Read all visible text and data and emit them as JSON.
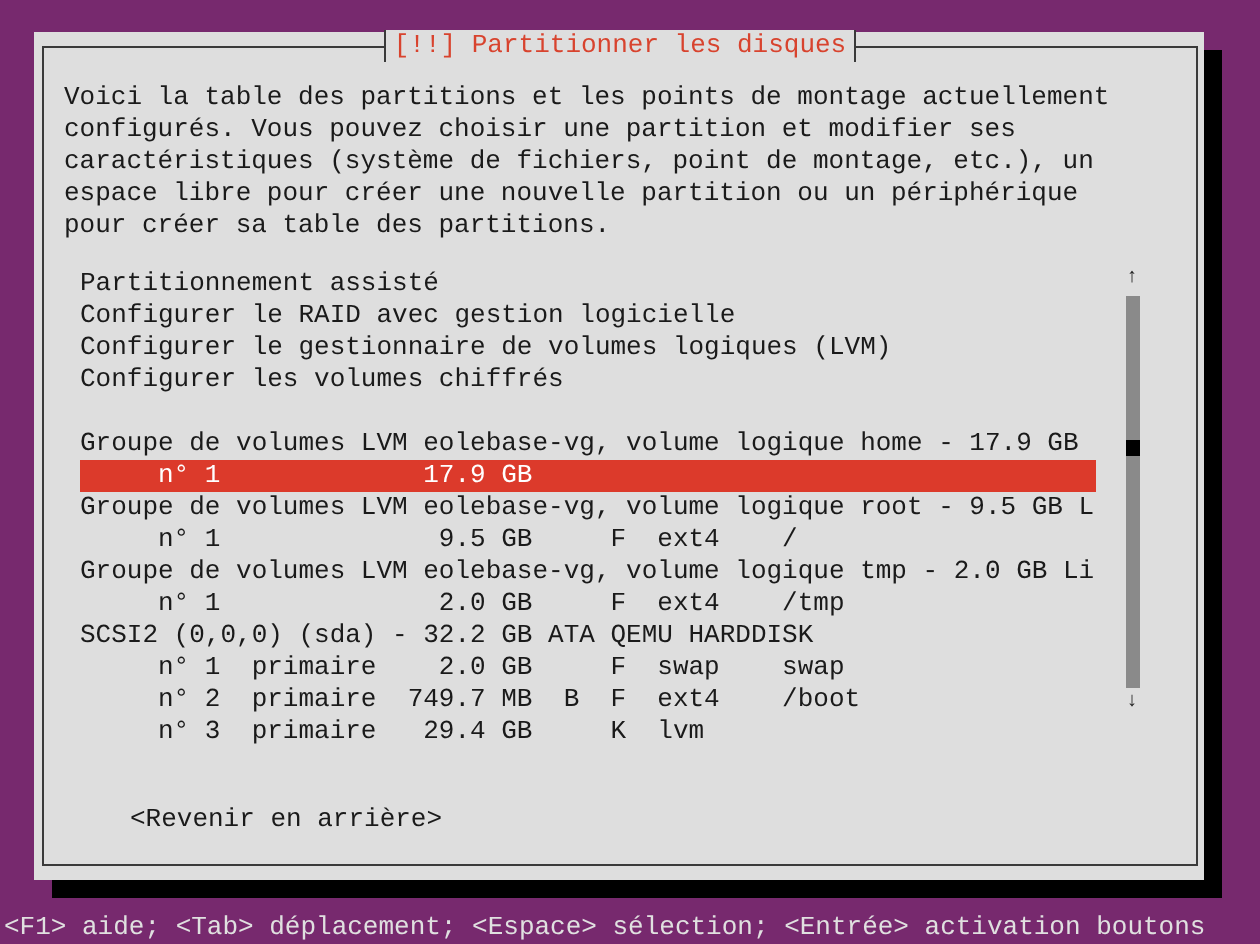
{
  "dialog": {
    "title": "[!!] Partitionner les disques",
    "description": "Voici la table des partitions et les points de montage actuellement\nconfigurés. Vous pouvez choisir une partition et modifier ses\ncaractéristiques (système de fichiers, point de montage, etc.), un\nespace libre pour créer une nouvelle partition ou un périphérique\npour créer sa table des partitions.",
    "list": [
      {
        "kind": "item",
        "text": "Partitionnement assisté",
        "selected": false
      },
      {
        "kind": "item",
        "text": "Configurer le RAID avec gestion logicielle",
        "selected": false
      },
      {
        "kind": "item",
        "text": "Configurer le gestionnaire de volumes logiques (LVM)",
        "selected": false
      },
      {
        "kind": "item",
        "text": "Configurer les volumes chiffrés",
        "selected": false
      },
      {
        "kind": "blank"
      },
      {
        "kind": "item",
        "text": "Groupe de volumes LVM eolebase-vg, volume logique home - 17.9 GB",
        "selected": false
      },
      {
        "kind": "item",
        "text": "     n° 1             17.9 GB",
        "selected": true
      },
      {
        "kind": "item",
        "text": "Groupe de volumes LVM eolebase-vg, volume logique root - 9.5 GB L",
        "selected": false
      },
      {
        "kind": "item",
        "text": "     n° 1              9.5 GB     F  ext4    /",
        "selected": false
      },
      {
        "kind": "item",
        "text": "Groupe de volumes LVM eolebase-vg, volume logique tmp - 2.0 GB Li",
        "selected": false
      },
      {
        "kind": "item",
        "text": "     n° 1              2.0 GB     F  ext4    /tmp",
        "selected": false
      },
      {
        "kind": "item",
        "text": "SCSI2 (0,0,0) (sda) - 32.2 GB ATA QEMU HARDDISK",
        "selected": false
      },
      {
        "kind": "item",
        "text": "     n° 1  primaire    2.0 GB     F  swap    swap",
        "selected": false
      },
      {
        "kind": "item",
        "text": "     n° 2  primaire  749.7 MB  B  F  ext4    /boot",
        "selected": false
      },
      {
        "kind": "item",
        "text": "     n° 3  primaire   29.4 GB     K  lvm",
        "selected": false
      }
    ],
    "scroll_up": "↑",
    "scroll_down": "↓",
    "back_button": "<Revenir en arrière>"
  },
  "status_bar": "<F1> aide; <Tab> déplacement; <Espace> sélection; <Entrée> activation boutons"
}
